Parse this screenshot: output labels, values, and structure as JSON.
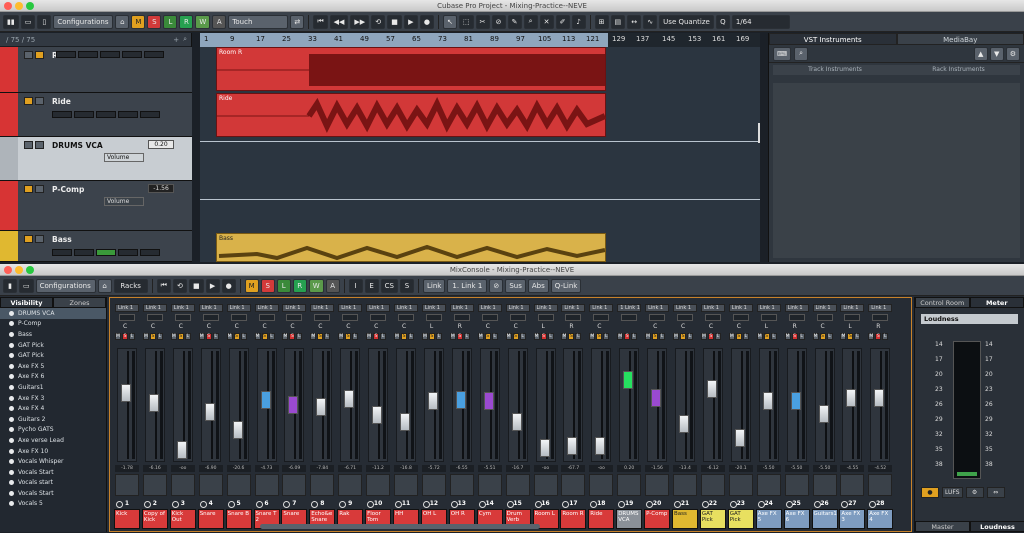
{
  "project": {
    "title": "Cubase Pro Project - Mixing-Practice--NEVE",
    "configurations_label": "Configurations",
    "automation_mode": "Touch",
    "quantize_label": "Use Quantize",
    "quantize_value": "1/64",
    "transport": {
      "m": "M",
      "s": "S",
      "l": "L",
      "r": "R",
      "w": "W",
      "a": "A"
    },
    "path_label": "/ 75 / 75",
    "tracks": [
      {
        "name": "Room R",
        "color": "#d73434"
      },
      {
        "name": "Ride",
        "color": "#d73434"
      },
      {
        "name": "DRUMS VCA",
        "color": "#aeb4ba",
        "value": "0.20",
        "vol_label": "Volume"
      },
      {
        "name": "P-Comp",
        "color": "#d73434",
        "value": "-1.56",
        "vol_label": "Volume"
      },
      {
        "name": "Bass",
        "color": "#e0b830"
      }
    ],
    "clips": {
      "ride": "Ride",
      "bass": "Bass",
      "room": "Room R"
    },
    "ruler": [
      "1",
      "9",
      "17",
      "25",
      "33",
      "41",
      "49",
      "57",
      "65",
      "73",
      "81",
      "89",
      "97",
      "105",
      "113",
      "121",
      "129",
      "137",
      "145",
      "153",
      "161",
      "169"
    ]
  },
  "vst": {
    "tab_instruments": "VST Instruments",
    "tab_mediabay": "MediaBay",
    "track_instruments": "Track Instruments",
    "rack_instruments": "Rack Instruments"
  },
  "mixconsole": {
    "title": "MixConsole - Mixing-Practice--NEVE",
    "configurations_label": "Configurations",
    "racks_label": "Racks",
    "toolbar": {
      "i": "I",
      "e": "E",
      "cs": "CS",
      "s": "S",
      "link": "Link",
      "link1": "1. Link 1",
      "sus_abs": "Sus",
      "abs": "Abs",
      "qlink": "Q-Link"
    },
    "visibility_tab": "Visibility",
    "zones_tab": "Zones",
    "visibility_items": [
      "DRUMS VCA",
      "P-Comp",
      "Bass",
      "GAT Pick",
      "GAT Pick",
      "Axe FX 5",
      "Axe FX 6",
      "Guitars1",
      "Axe FX 3",
      "Axe FX 4",
      "Guitars 2",
      "Pycho GATS",
      "Axe verse Lead",
      "Axe FX 10",
      "Vocals Whisper",
      "Vocals Start",
      "Vocals start",
      "Vocals Start",
      "Vocals 5"
    ],
    "channels": [
      {
        "num": "1",
        "name": "Kick",
        "link": "Link 1",
        "pan": "C",
        "val": "-1.78",
        "color": "#d83a3a",
        "pos": 35
      },
      {
        "num": "2",
        "name": "Copy of Kick",
        "link": "Link 1",
        "pan": "C",
        "val": "-6.16",
        "color": "#d83a3a",
        "pos": 45
      },
      {
        "num": "3",
        "name": "Kick Out",
        "link": "Link 1",
        "pan": "C",
        "val": "-oo",
        "color": "#d83a3a",
        "pos": 92
      },
      {
        "num": "4",
        "name": "Snare",
        "link": "Link 1",
        "pan": "C",
        "val": "-6.90",
        "color": "#d83a3a",
        "pos": 54
      },
      {
        "num": "5",
        "name": "Snare B",
        "link": "Link 1",
        "pan": "C",
        "val": "-20.6",
        "color": "#d83a3a",
        "pos": 72
      },
      {
        "num": "6",
        "name": "Snare T 2",
        "link": "Link 1",
        "pan": "C",
        "val": "-4.73",
        "color": "#d83a3a",
        "pos": 42
      },
      {
        "num": "7",
        "name": "Snare",
        "link": "Link 1",
        "pan": "C",
        "val": "-6.09",
        "color": "#d83a3a",
        "pos": 47
      },
      {
        "num": "8",
        "name": "Echo&e Snare",
        "link": "Link 1",
        "pan": "C",
        "val": "-7.84",
        "color": "#d83a3a",
        "pos": 49
      },
      {
        "num": "9",
        "name": "Rak",
        "link": "Link 1",
        "pan": "C",
        "val": "-6.71",
        "color": "#d83a3a",
        "pos": 41
      },
      {
        "num": "10",
        "name": "Floor Tom",
        "link": "Link 1",
        "pan": "C",
        "val": "-11.2",
        "color": "#d83a3a",
        "pos": 57
      },
      {
        "num": "11",
        "name": "HH",
        "link": "Link 1",
        "pan": "C",
        "val": "-16.8",
        "color": "#d83a3a",
        "pos": 64
      },
      {
        "num": "12",
        "name": "OH L",
        "link": "Link 1",
        "pan": "L",
        "val": "-5.72",
        "color": "#d83a3a",
        "pos": 43
      },
      {
        "num": "13",
        "name": "OH R",
        "link": "Link 1",
        "pan": "R",
        "val": "-6.55",
        "color": "#d83a3a",
        "pos": 42
      },
      {
        "num": "14",
        "name": "Cym",
        "link": "Link 1",
        "pan": "C",
        "val": "-5.51",
        "color": "#d83a3a",
        "pos": 43
      },
      {
        "num": "15",
        "name": "Drum Verb",
        "link": "Link 1",
        "pan": "C",
        "val": "-16.7",
        "color": "#d83a3a",
        "pos": 64
      },
      {
        "num": "16",
        "name": "Room L",
        "link": "Link 1",
        "pan": "L",
        "val": "-oo",
        "color": "#d83a3a",
        "pos": 90
      },
      {
        "num": "17",
        "name": "Room R",
        "link": "Link 1",
        "pan": "R",
        "val": "-67.7",
        "color": "#d83a3a",
        "pos": 88
      },
      {
        "num": "18",
        "name": "Ride",
        "link": "Link 1",
        "pan": "C",
        "val": "-oo",
        "color": "#d83a3a",
        "pos": 88
      },
      {
        "num": "19",
        "name": "DRUMS VCA",
        "link": "1 Link 1",
        "pan": "",
        "val": "0.20",
        "color": "#8a9098",
        "pos": 22
      },
      {
        "num": "20",
        "name": "P-Comp",
        "link": "Link 1",
        "pan": "C",
        "val": "-1.56",
        "color": "#d83a3a",
        "pos": 40
      },
      {
        "num": "21",
        "name": "Bass",
        "link": "Link 1",
        "pan": "C",
        "val": "-13.4",
        "color": "#e0b830",
        "pos": 66
      },
      {
        "num": "22",
        "name": "GAT Pick",
        "link": "Link 1",
        "pan": "C",
        "val": "-6.12",
        "color": "#e8e060",
        "pos": 31
      },
      {
        "num": "23",
        "name": "GAT Pick",
        "link": "Link 1",
        "pan": "C",
        "val": "-20.1",
        "color": "#e8e060",
        "pos": 80
      },
      {
        "num": "24",
        "name": "Axe FX 5",
        "link": "Link 1",
        "pan": "L",
        "val": "-5.50",
        "color": "#7e9cc0",
        "pos": 43
      },
      {
        "num": "25",
        "name": "Axe FX 6",
        "link": "Link 1",
        "pan": "R",
        "val": "-5.50",
        "color": "#7e9cc0",
        "pos": 43
      },
      {
        "num": "26",
        "name": "Guitars1",
        "link": "Link 1",
        "pan": "C",
        "val": "-5.50",
        "color": "#7e9cc0",
        "pos": 56
      },
      {
        "num": "27",
        "name": "Axe FX 3",
        "link": "Link 1",
        "pan": "L",
        "val": "-4.55",
        "color": "#7e9cc0",
        "pos": 40
      },
      {
        "num": "28",
        "name": "Axe FX 4",
        "link": "Link 1",
        "pan": "R",
        "val": "-4.52",
        "color": "#7e9cc0",
        "pos": 40
      }
    ],
    "control_room_tab": "Control Room",
    "meter_tab": "Meter",
    "loudness_select": "Loudness",
    "meter_ticks": [
      "14",
      "17",
      "20",
      "23",
      "26",
      "29",
      "32",
      "35",
      "38"
    ],
    "lufs_label": "LUFS",
    "master_tab": "Master",
    "loudness_tab": "Loudness"
  }
}
